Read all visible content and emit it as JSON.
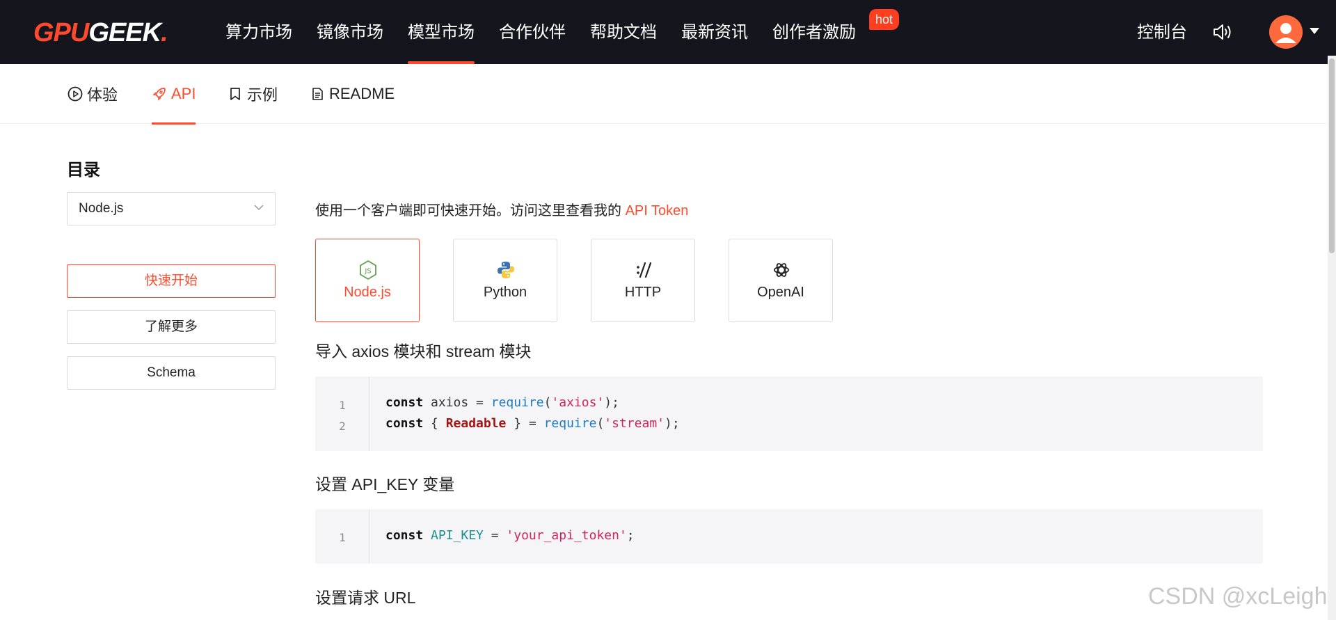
{
  "brand": {
    "part1": "GPU",
    "part2": "GEEK",
    "part3": "."
  },
  "nav": {
    "items": [
      {
        "label": "算力市场"
      },
      {
        "label": "镜像市场"
      },
      {
        "label": "模型市场",
        "active": true
      },
      {
        "label": "合作伙伴"
      },
      {
        "label": "帮助文档"
      },
      {
        "label": "最新资讯"
      },
      {
        "label": "创作者激励"
      }
    ],
    "hot_badge": "hot",
    "console": "控制台"
  },
  "tabs": [
    {
      "label": "体验",
      "icon": "play-circle-icon"
    },
    {
      "label": "API",
      "icon": "rocket-icon",
      "active": true
    },
    {
      "label": "示例",
      "icon": "bookmark-icon"
    },
    {
      "label": "README",
      "icon": "document-icon"
    }
  ],
  "sidebar": {
    "title": "目录",
    "select_value": "Node.js",
    "buttons": [
      {
        "label": "快速开始",
        "primary": true
      },
      {
        "label": "了解更多"
      },
      {
        "label": "Schema"
      }
    ]
  },
  "main": {
    "intro": "使用一个客户端即可快速开始。访问这里查看我的",
    "intro_link": "API Token",
    "languages": [
      {
        "label": "Node.js",
        "icon": "nodejs-icon",
        "active": true
      },
      {
        "label": "Python",
        "icon": "python-icon"
      },
      {
        "label": "HTTP",
        "icon": "http-icon"
      },
      {
        "label": "OpenAI",
        "icon": "openai-icon"
      }
    ],
    "sections": [
      {
        "title": "导入 axios 模块和 stream 模块",
        "lines": [
          {
            "no": "1",
            "text": "const axios = require('axios');"
          },
          {
            "no": "2",
            "text": "const { Readable } = require('stream');"
          }
        ]
      },
      {
        "title": "设置 API_KEY 变量",
        "lines": [
          {
            "no": "1",
            "text": "const API_KEY = 'your_api_token';"
          }
        ]
      },
      {
        "title": "设置请求 URL"
      }
    ]
  },
  "watermark": "CSDN @xcLeigh",
  "colors": {
    "accent": "#ff4a2d",
    "topbar": "#15161d",
    "code_bg": "#f5f5f7"
  }
}
